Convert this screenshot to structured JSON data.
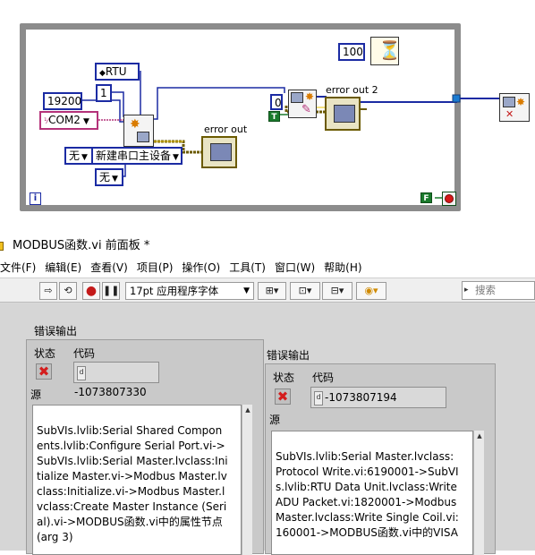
{
  "diagram": {
    "constants": {
      "rtu": "RTU",
      "baud": "19200",
      "slave_id": "1",
      "com_port": "COM2",
      "parity": "无",
      "flow": "无",
      "mode": "新建串口主设备",
      "zero": "0",
      "wait_ms": "100",
      "true_const": "T",
      "false_const": "F",
      "iteration": "i"
    },
    "labels": {
      "error_out": "error out",
      "error_out_2": "error out 2"
    }
  },
  "window": {
    "title": "MODBUS函数.vi 前面板 *",
    "menu": [
      "文件(F)",
      "编辑(E)",
      "查看(V)",
      "项目(P)",
      "操作(O)",
      "工具(T)",
      "窗口(W)",
      "帮助(H)"
    ],
    "toolbar": {
      "font": "17pt 应用程序字体",
      "search_placeholder": "搜索"
    }
  },
  "error_left": {
    "title": "错误输出",
    "status_label": "状态",
    "code_label": "代码",
    "code": "-1073807330",
    "source_label": "源",
    "source": "SubVIs.lvlib:Serial Shared Components.lvlib:Configure Serial Port.vi->SubVIs.lvlib:Serial Master.lvclass:Initialize Master.vi->Modbus Master.lvclass:Initialize.vi->Modbus Master.lvclass:Create Master Instance (Serial).vi->MODBUS函数.vi中的属性节点 (arg 3)"
  },
  "error_right": {
    "title": "错误输出",
    "status_label": "状态",
    "code_label": "代码",
    "code": "-1073807194",
    "source_label": "源",
    "source": "SubVIs.lvlib:Serial Master.lvclass:Protocol Write.vi:6190001->SubVIs.lvlib:RTU Data Unit.lvclass:Write ADU Packet.vi:1820001->Modbus Master.lvclass:Write Single Coil.vi:160001->MODBUS函数.vi中的VISA"
  }
}
